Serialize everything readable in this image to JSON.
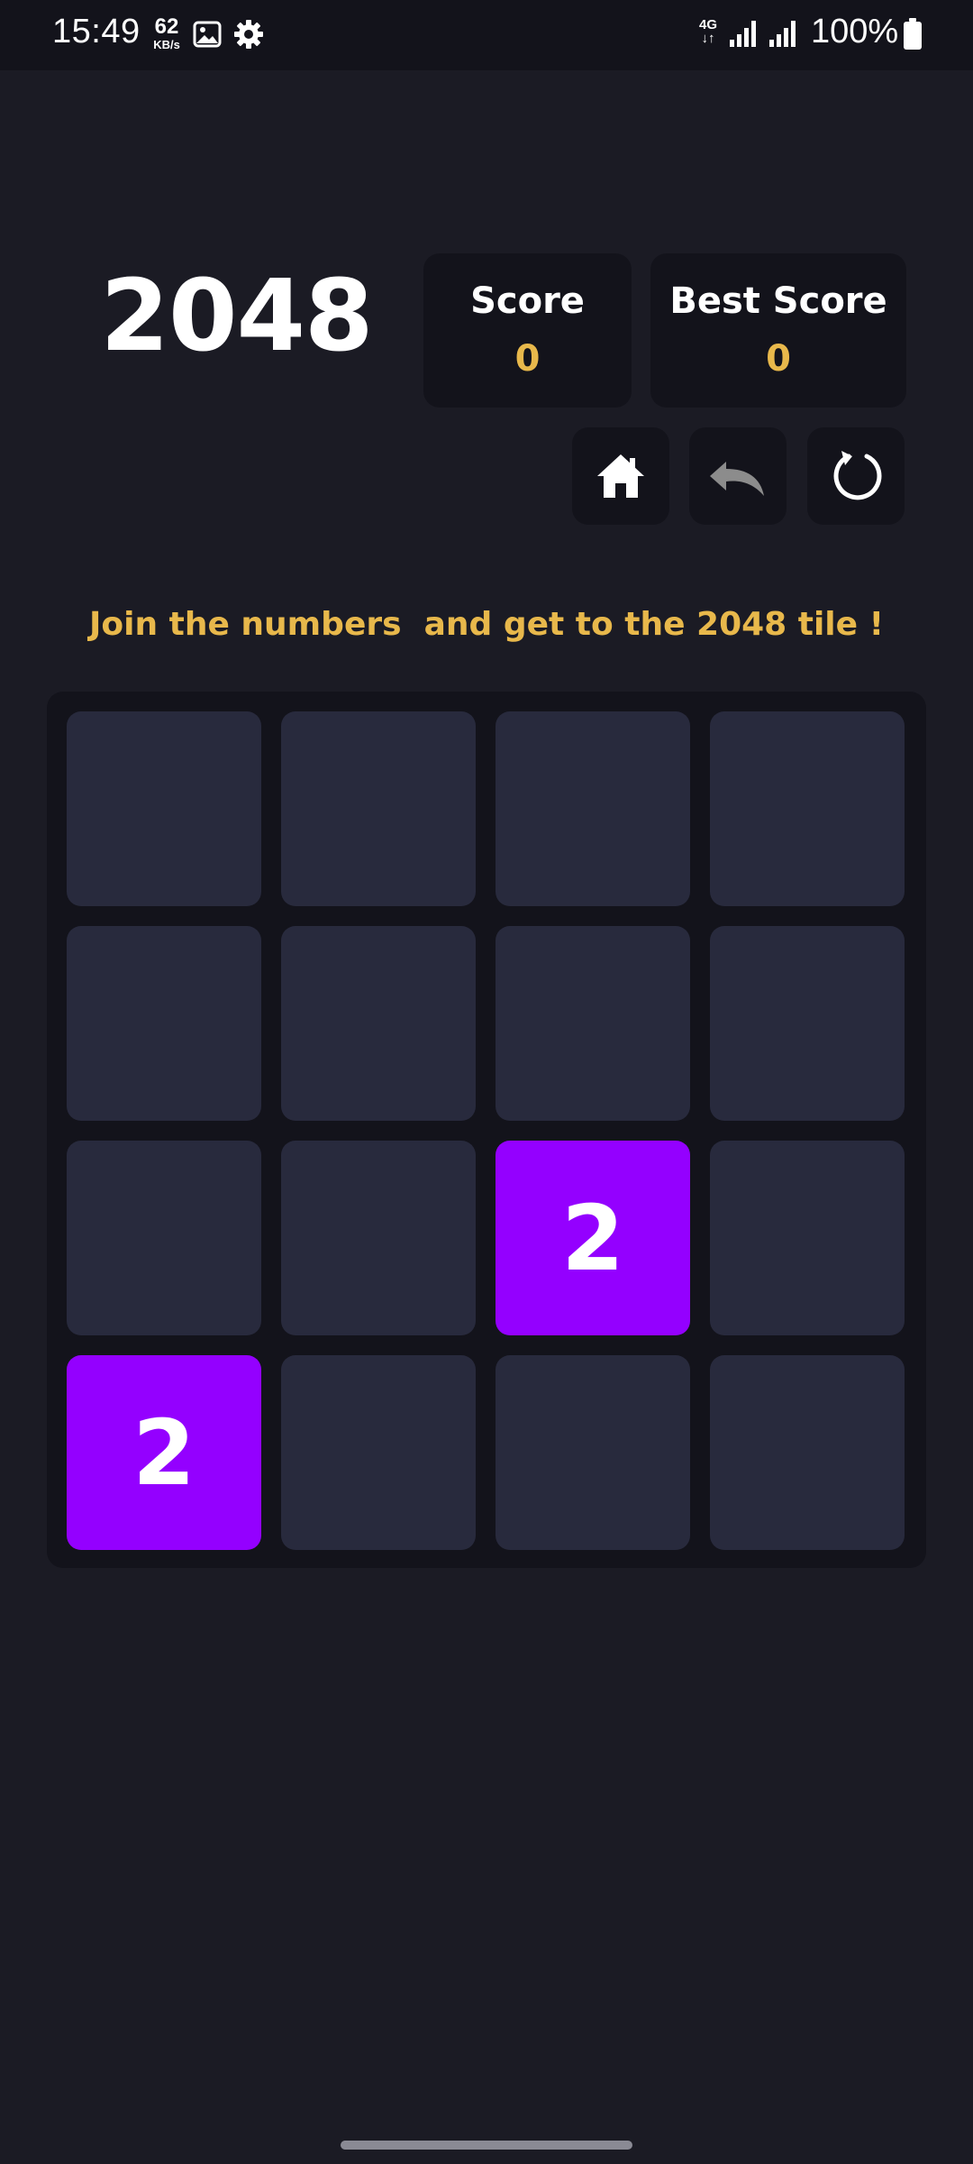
{
  "status_bar": {
    "time": "15:49",
    "net_speed_value": "62",
    "net_speed_unit": "KB/s",
    "network_type": "4G",
    "battery": "100%"
  },
  "game": {
    "title": "2048",
    "score_label": "Score",
    "score_value": "0",
    "best_label": "Best Score",
    "best_value": "0",
    "hint": "Join the numbers  and get to the 2048 tile !",
    "buttons": [
      "home-icon",
      "undo-icon",
      "restart-icon"
    ],
    "tile_color": "#9400ff",
    "accent_color": "#e8b84b",
    "board": [
      [
        "",
        "",
        "",
        ""
      ],
      [
        "",
        "",
        "",
        ""
      ],
      [
        "",
        "",
        "2",
        ""
      ],
      [
        "2",
        "",
        "",
        ""
      ]
    ]
  }
}
